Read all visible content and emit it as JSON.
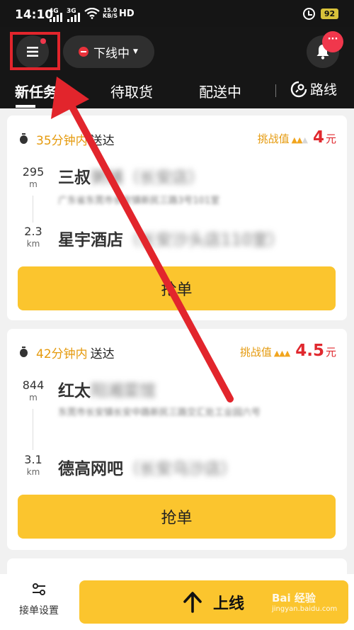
{
  "status_bar": {
    "time": "14:10",
    "sig1": "4G",
    "sig2": "3G",
    "speed_top": "15.0",
    "speed_bottom": "KB/S",
    "hd": "HD",
    "battery": "92"
  },
  "header": {
    "status_label": "下线中",
    "bell_badge": "···"
  },
  "tabs": [
    {
      "label": "新任务"
    },
    {
      "label": "待取货"
    },
    {
      "label": "配送中"
    }
  ],
  "route_label": "路线",
  "orders": [
    {
      "eta_minutes": "35分钟内",
      "eta_suffix": "送达",
      "challenge_label": "挑战值",
      "price": "4",
      "price_unit": "元",
      "pickup_distance": "295",
      "pickup_unit": "m",
      "pickup_name": "三叔",
      "pickup_name_blur": "粥铺（长安店）",
      "pickup_addr": "广东省东莞市长安镇新民三路3号101室",
      "drop_distance": "2.3",
      "drop_unit": "km",
      "drop_name": "星宇酒店",
      "drop_name_blur": "（长安沙头店110室）",
      "button": "抢单"
    },
    {
      "eta_minutes": "42分钟内",
      "eta_suffix": "送达",
      "challenge_label": "挑战值",
      "price": "4.5",
      "price_unit": "元",
      "pickup_distance": "844",
      "pickup_unit": "m",
      "pickup_name": "红太",
      "pickup_name_blur": "阳湘菜馆",
      "pickup_addr": "东莞市长安镇长安中路新民三路交汇处工业园六号",
      "drop_distance": "3.1",
      "drop_unit": "km",
      "drop_name": "德高网吧",
      "drop_name_blur": "（长安乌沙店）",
      "button": "抢单"
    }
  ],
  "bottom": {
    "settings_label": "接单设置",
    "online_label": "上线"
  },
  "watermark": {
    "brand": "Bai 经验",
    "url": "jingyan.baidu.com"
  },
  "colors": {
    "accent": "#fbc52e",
    "price": "#e0282e",
    "eta": "#e59a0d",
    "annotation": "#e2252c"
  }
}
